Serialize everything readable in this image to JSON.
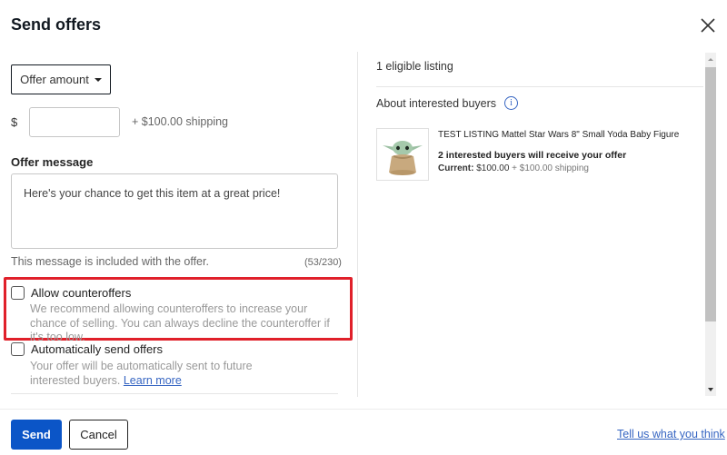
{
  "dialog": {
    "title": "Send offers",
    "close_icon": "close-icon"
  },
  "offer": {
    "select_label": "Offer amount",
    "selected_option": "Offer amount",
    "currency_symbol": "$",
    "amount_value": "",
    "shipping_note": "+ $100.00 shipping"
  },
  "message": {
    "label": "Offer message",
    "value": "Here's your chance to get this item at a great price!",
    "help_text": "This message is included with the offer.",
    "char_count": "(53/230)"
  },
  "options": {
    "counteroffers": {
      "label": "Allow counteroffers",
      "checked": false,
      "description": "We recommend allowing counteroffers to increase your chance of selling. You can always decline the counteroffer if it's too low."
    },
    "auto_send": {
      "label": "Automatically send offers",
      "checked": false,
      "description": "Your offer will be automatically sent to future interested buyers.",
      "link_text": "Learn more"
    }
  },
  "listings": {
    "eligible_count_text": "1 eligible listing",
    "about_buyers_label": "About interested buyers",
    "info_icon": "info-icon",
    "items": [
      {
        "title": "TEST LISTING Mattel Star Wars 8\" Small Yoda Baby Figure",
        "buyers_text": "2 interested buyers will receive your offer",
        "current_label": "Current:",
        "current_price": "$100.00",
        "current_shipping": "+ $100.00 shipping"
      }
    ]
  },
  "footer": {
    "send_label": "Send",
    "cancel_label": "Cancel",
    "feedback_link": "Tell us what you think"
  },
  "colors": {
    "primary": "#0b55c7",
    "link": "#3665c2",
    "highlight": "#e0202a"
  }
}
